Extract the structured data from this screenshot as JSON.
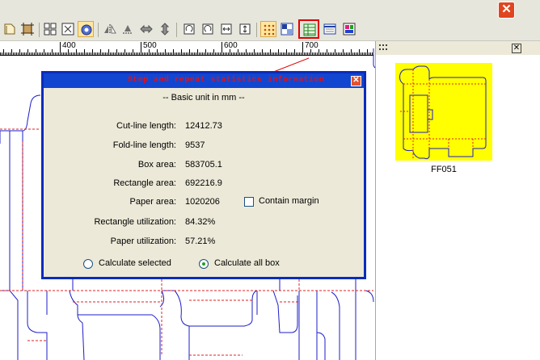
{
  "window": {
    "close_glyph": "✕"
  },
  "toolbar": {
    "buttons": [
      {
        "icon": "page-icon"
      },
      {
        "icon": "crop-icon"
      },
      {
        "icon": "grid-icon"
      },
      {
        "icon": "fit-icon"
      },
      {
        "icon": "settings-icon"
      },
      {
        "icon": "mirror-left-icon"
      },
      {
        "icon": "mirror-right-icon"
      },
      {
        "icon": "horizontal-arrow-icon"
      },
      {
        "icon": "vertical-arrow-icon"
      },
      {
        "icon": "rotate-left-icon"
      },
      {
        "icon": "rotate-right-icon"
      },
      {
        "icon": "flip-horizontal-icon"
      },
      {
        "icon": "flip-vertical-icon"
      },
      {
        "icon": "dots-grid-icon"
      },
      {
        "icon": "tiles-icon"
      },
      {
        "icon": "statistics-icon"
      },
      {
        "icon": "table-icon"
      },
      {
        "icon": "color-layout-icon"
      }
    ]
  },
  "ruler": {
    "labels": [
      "400",
      "500",
      "600",
      "700"
    ]
  },
  "dialog": {
    "title": "Step and repeat statistics information",
    "close_glyph": "✕",
    "subtitle": "-- Basic unit in mm --",
    "rows": [
      {
        "label": "Cut-line length:",
        "value": "12412.73"
      },
      {
        "label": "Fold-line length:",
        "value": "9537"
      },
      {
        "label": "Box area:",
        "value": "583705.1"
      },
      {
        "label": "Rectangle area:",
        "value": "692216.9"
      },
      {
        "label": "Paper area:",
        "value": "1020206"
      },
      {
        "label": "Rectangle utilization:",
        "value": "84.32%"
      },
      {
        "label": "Paper utilization:",
        "value": "57.21%"
      }
    ],
    "contain_margin": {
      "label": "Contain margin",
      "checked": false
    },
    "radio_selected": {
      "label": "Calculate selected",
      "checked": false
    },
    "radio_all": {
      "label": "Calculate all box",
      "checked": true
    }
  },
  "side_panel": {
    "close_glyph": "✕",
    "thumbnail": {
      "name": "FF051",
      "background": "#ffff00"
    }
  },
  "colors": {
    "cut_line": "#1c1cc8",
    "fold_line": "#e02020",
    "accent": "#1246d0"
  }
}
